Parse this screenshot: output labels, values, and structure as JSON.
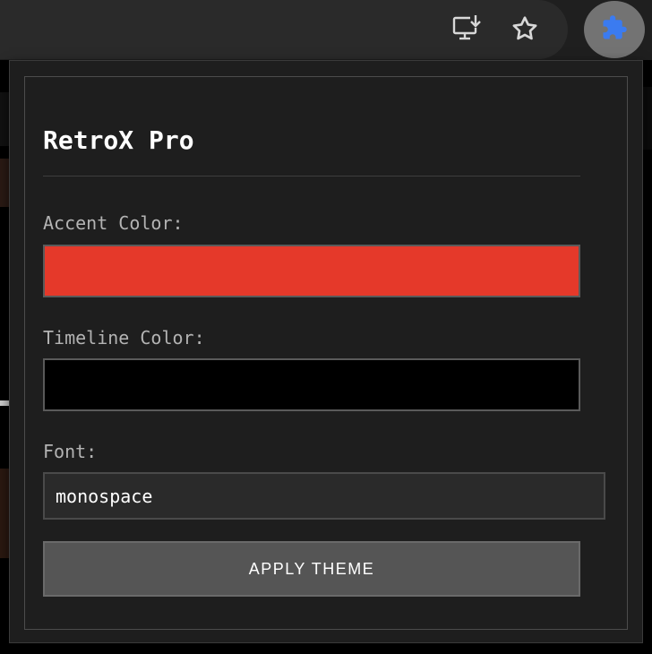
{
  "toolbar": {
    "install_icon": "install-app-icon",
    "bookmark_icon": "star-icon",
    "extension_icon": "puzzle-icon"
  },
  "popup": {
    "title": "RetroX Pro",
    "accent_label": "Accent Color:",
    "accent_color": "#e5392a",
    "timeline_label": "Timeline Color:",
    "timeline_color": "#000000",
    "font_label": "Font:",
    "font_value": "monospace",
    "apply_label": "APPLY THEME"
  },
  "colors": {
    "popup_bg": "#1e1e1e",
    "button_bg": "#555555",
    "extension_icon": "#3b7bf0"
  }
}
